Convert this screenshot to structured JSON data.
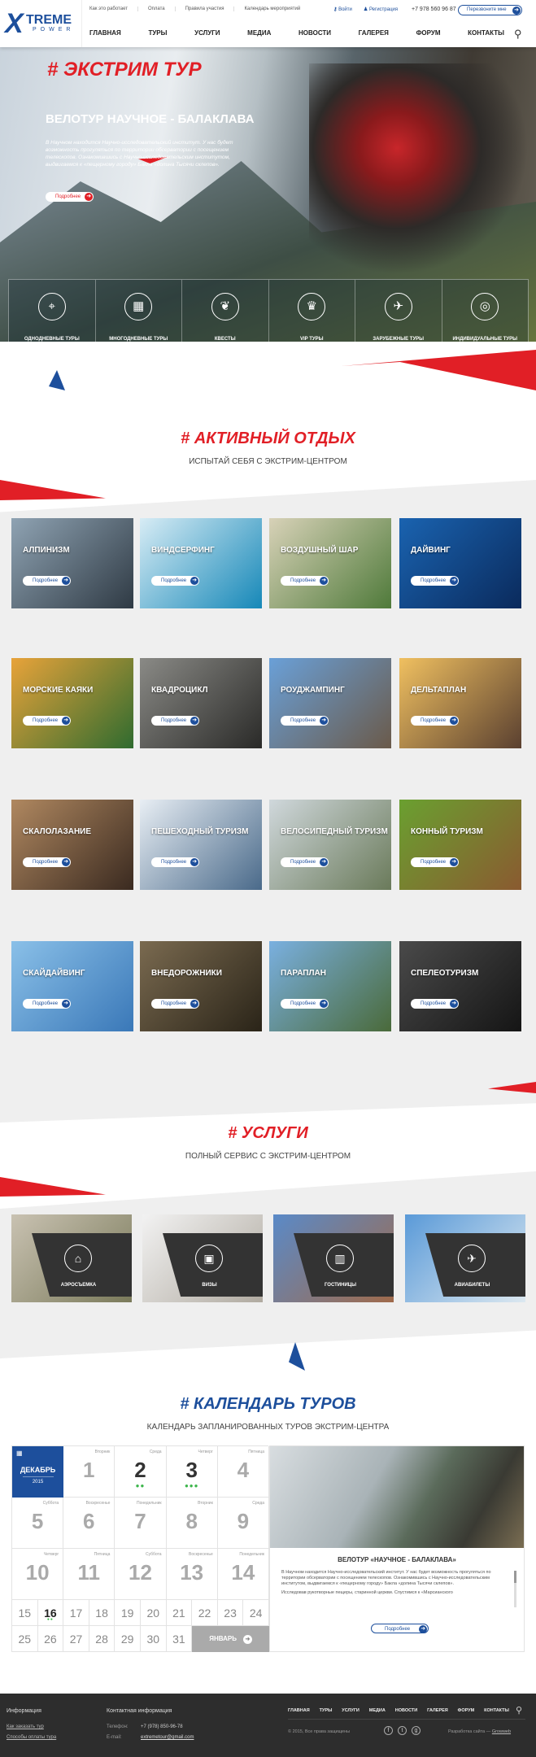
{
  "brand": {
    "logo_x": "X",
    "logo_text": "TREME",
    "logo_sub": "POWER"
  },
  "topbar": {
    "links": [
      "Как это работает",
      "Оплата",
      "Правила участия",
      "Календарь мероприятий"
    ],
    "login": "Войти",
    "register": "Регистрация",
    "phone": "+7 978 560 96 87",
    "callback": "Перезвоните мне"
  },
  "nav": [
    "ГЛАВНАЯ",
    "ТУРЫ",
    "УСЛУГИ",
    "МЕДИА",
    "НОВОСТИ",
    "ГАЛЕРЕЯ",
    "ФОРУМ",
    "КОНТАКТЫ"
  ],
  "hero": {
    "tag": "# ЭКСТРИМ ТУР",
    "title": "ВЕЛОТУР НАУЧНОЕ - БАЛАКЛАВА",
    "desc": "В Научном находится Научно-исследовательский институт. У нас будет возможность прогуляться по территории обсерватории с посещением телескопов. Ознакомившись с Научно-исследовательским институтом, выдвигаемся к «пещерному городу» Бакла «долина Тысячи склепов».",
    "button": "Подробнее"
  },
  "tour_categories": [
    {
      "label": "ОДНОДНЕВНЫЕ ТУРЫ",
      "icon": "map-pin-icon",
      "glyph": "⌖"
    },
    {
      "label": "МНОГОДНЕВНЫЕ ТУРЫ",
      "icon": "calendar-icon",
      "glyph": "▦"
    },
    {
      "label": "КВЕСТЫ",
      "icon": "brain-icon",
      "glyph": "❦"
    },
    {
      "label": "VIP ТУРЫ",
      "icon": "crown-icon",
      "glyph": "♛"
    },
    {
      "label": "ЗАРУБЕЖНЫЕ ТУРЫ",
      "icon": "plane-icon",
      "glyph": "✈"
    },
    {
      "label": "ИНДИВИДУАЛЬНЫЕ ТУРЫ",
      "icon": "compass-icon",
      "glyph": "◎"
    }
  ],
  "active": {
    "title": "# АКТИВНЫЙ ОТДЫХ",
    "subtitle": "ИСПЫТАЙ СЕБЯ С ЭКСТРИМ-ЦЕНТРОМ",
    "button": "Подробнее",
    "items": [
      {
        "label": "АЛПИНИЗМ",
        "c1": "#8fa3b3",
        "c2": "#2f3a44"
      },
      {
        "label": "ВИНДСЕРФИНГ",
        "c1": "#d7ecf5",
        "c2": "#1688b8"
      },
      {
        "label": "ВОЗДУШНЫЙ ШАР",
        "c1": "#d8d2b8",
        "c2": "#4f7a3a"
      },
      {
        "label": "ДАЙВИНГ",
        "c1": "#1a63b0",
        "c2": "#0a2a5c"
      },
      {
        "label": "МОРСКИЕ КАЯКИ",
        "c1": "#e8a33a",
        "c2": "#2f6b2f"
      },
      {
        "label": "КВАДРОЦИКЛ",
        "c1": "#8a8a86",
        "c2": "#2a2a28"
      },
      {
        "label": "РОУДЖАМПИНГ",
        "c1": "#6aa0d8",
        "c2": "#6a5a4a"
      },
      {
        "label": "ДЕЛЬТАПЛАН",
        "c1": "#f0c060",
        "c2": "#5a4030"
      },
      {
        "label": "СКАЛОЛАЗАНИЕ",
        "c1": "#b08860",
        "c2": "#3a2a20"
      },
      {
        "label": "ПЕШЕХОДНЫЙ ТУРИЗМ",
        "c1": "#e8eef4",
        "c2": "#4a6a8a"
      },
      {
        "label": "ВЕЛОСИПЕДНЫЙ ТУРИЗМ",
        "c1": "#d0d8dc",
        "c2": "#6a7a5a"
      },
      {
        "label": "КОННЫЙ ТУРИЗМ",
        "c1": "#6aa030",
        "c2": "#8a5a30"
      },
      {
        "label": "СКАЙДАЙВИНГ",
        "c1": "#8ac0e8",
        "c2": "#3a78b8"
      },
      {
        "label": "ВНЕДОРОЖНИКИ",
        "c1": "#7a6a50",
        "c2": "#2a2418"
      },
      {
        "label": "ПАРАПЛАН",
        "c1": "#7ab0e0",
        "c2": "#4a6a3a"
      },
      {
        "label": "СПЕЛЕОТУРИЗМ",
        "c1": "#4a4a4a",
        "c2": "#151515"
      }
    ]
  },
  "services": {
    "title": "# УСЛУГИ",
    "subtitle": "ПОЛНЫЙ СЕРВИС С ЭКСТРИМ-ЦЕНТРОМ",
    "items": [
      {
        "label": "АЭРОСЪЕМКА",
        "icon": "drone-icon",
        "glyph": "⌂",
        "c1": "#c9c2b2",
        "c2": "#7a7a5a"
      },
      {
        "label": "ВИЗЫ",
        "icon": "passport-icon",
        "glyph": "▣",
        "c1": "#f2f2f2",
        "c2": "#b0aaa0"
      },
      {
        "label": "ГОСТИНИЦЫ",
        "icon": "hotel-icon",
        "glyph": "▥",
        "c1": "#5a8ac8",
        "c2": "#a06a4a"
      },
      {
        "label": "АВИАБИЛЕТЫ",
        "icon": "ticket-icon",
        "glyph": "✈",
        "c1": "#5a9ad8",
        "c2": "#dce8f0"
      }
    ]
  },
  "calendar": {
    "title": "# КАЛЕНДАРЬ ТУРОВ",
    "subtitle": "КАЛЕНДАРЬ ЗАПЛАНИРОВАННЫХ ТУРОВ ЭКСТРИМ-ЦЕНТРА",
    "month": "ДЕКАБРЬ",
    "year": "2015",
    "next": "ЯНВАРЬ",
    "big_days": [
      {
        "d": "1",
        "w": "Вторник",
        "ev": 0
      },
      {
        "d": "2",
        "w": "Среда",
        "ev": 2
      },
      {
        "d": "3",
        "w": "Четверг",
        "ev": 3
      },
      {
        "d": "4",
        "w": "Пятница",
        "ev": 0
      },
      {
        "d": "5",
        "w": "Суббота",
        "ev": 0
      },
      {
        "d": "6",
        "w": "Воскресенье",
        "ev": 0
      },
      {
        "d": "7",
        "w": "Понедельник",
        "ev": 0
      },
      {
        "d": "8",
        "w": "Вторник",
        "ev": 0
      },
      {
        "d": "9",
        "w": "Среда",
        "ev": 0
      },
      {
        "d": "10",
        "w": "Четверг",
        "ev": 0
      },
      {
        "d": "11",
        "w": "Пятница",
        "ev": 0
      },
      {
        "d": "12",
        "w": "Суббота",
        "ev": 0
      },
      {
        "d": "13",
        "w": "Воскресенье",
        "ev": 0
      },
      {
        "d": "14",
        "w": "Понедельник",
        "ev": 0
      }
    ],
    "small_days": [
      {
        "d": "15",
        "ev": 0
      },
      {
        "d": "16",
        "ev": 2
      },
      {
        "d": "17",
        "ev": 0
      },
      {
        "d": "18",
        "ev": 0
      },
      {
        "d": "19",
        "ev": 0
      },
      {
        "d": "20",
        "ev": 0
      },
      {
        "d": "21",
        "ev": 0
      },
      {
        "d": "22",
        "ev": 0
      },
      {
        "d": "23",
        "ev": 0
      },
      {
        "d": "24",
        "ev": 0
      },
      {
        "d": "25",
        "ev": 0
      },
      {
        "d": "26",
        "ev": 0
      },
      {
        "d": "27",
        "ev": 0
      },
      {
        "d": "28",
        "ev": 0
      },
      {
        "d": "29",
        "ev": 0
      },
      {
        "d": "30",
        "ev": 0
      },
      {
        "d": "31",
        "ev": 0
      }
    ],
    "tour": {
      "title": "ВЕЛОТУР «НАУЧНОЕ - БАЛАКЛАВА»",
      "p1": "В Научном находится Научно-исследовательский институт. У нас будет возможность прогуляться по территории обсерватории с посещением телескопов. Ознакомившись с Научно-исследовательским институтом, выдвигаемся к «пещерному городу» Бакла «долина Тысячи склепов».",
      "p2": "Исследовав рукотворные пещеры, старинной церкви. Спустимся к «Марсианского",
      "button": "Подробнее"
    }
  },
  "footer": {
    "info_title": "Информация",
    "info_links": [
      "Как заказать тур",
      "Способы оплаты тура"
    ],
    "contact_title": "Контактная информация",
    "phone_label": "Телефон:",
    "phone": "+7 (978) 850-96-78",
    "email_label": "E-mail:",
    "email": "extremetour@gmail.com",
    "nav": [
      "ГЛАВНАЯ",
      "ТУРЫ",
      "УСЛУГИ",
      "МЕДИА",
      "НОВОСТИ",
      "ГАЛЕРЕЯ",
      "ФОРУМ",
      "КОНТАКТЫ"
    ],
    "copyright": "© 2015, Все права защищены",
    "dev_label": "Разработка сайта —",
    "dev_link": "Growweb"
  },
  "colors": {
    "red": "#e11f26",
    "blue": "#1d4f9c",
    "dark": "#2d2d2d",
    "green": "#3bb54a"
  }
}
